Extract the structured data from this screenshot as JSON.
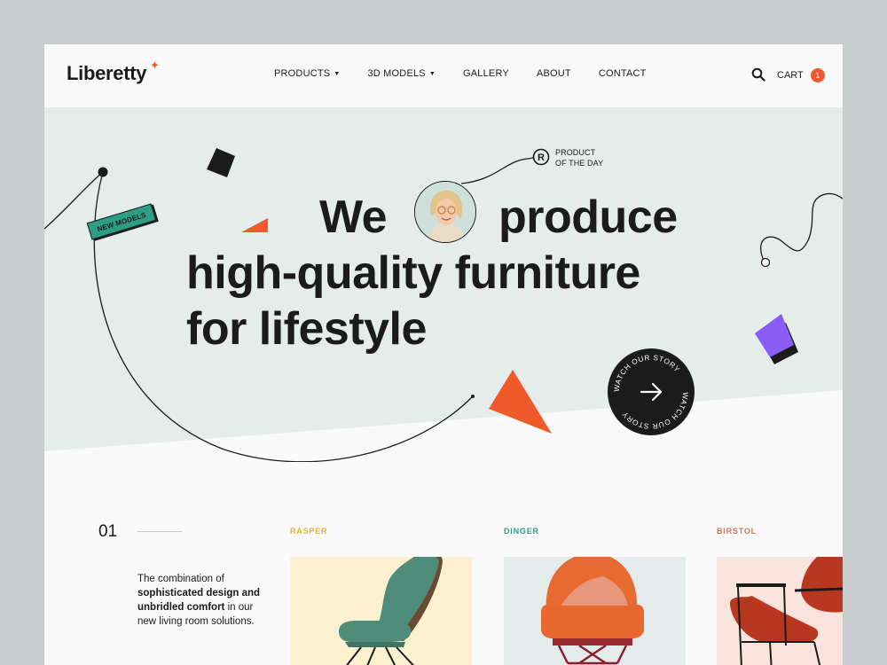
{
  "header": {
    "logo": "Liberetty",
    "nav": [
      {
        "label": "PRODUCTS",
        "dropdown": true
      },
      {
        "label": "3D MODELS",
        "dropdown": true
      },
      {
        "label": "GALLERY",
        "dropdown": false
      },
      {
        "label": "ABOUT",
        "dropdown": false
      },
      {
        "label": "CONTACT",
        "dropdown": false
      }
    ],
    "cart_label": "CART",
    "cart_count": "1"
  },
  "hero": {
    "headline_we": "We",
    "headline_produce": "produce",
    "headline_line2": "high-quality furniture",
    "headline_line3": "for lifestyle",
    "tag": "NEW MODELS",
    "product_of_day_line1": "PRODUCT",
    "product_of_day_line2": "OF THE DAY",
    "watch_text": "WATCH OUR STORY",
    "colors": {
      "bg": "#e5edeb",
      "accent": "#f05a2a",
      "purple": "#8a5cf6",
      "green": "#2d9d86"
    }
  },
  "products": {
    "index": "01",
    "description_pre": "The combination of",
    "description_bold": "sophisticated design and unbridled comfort",
    "description_post": "in our new living room solutions.",
    "items": [
      {
        "name": "RASPER",
        "color": "#e0b43c",
        "bg": "#fdf1cf"
      },
      {
        "name": "DINGER",
        "color": "#2d9d86",
        "bg": "#e3ecea"
      },
      {
        "name": "BIRSTOL",
        "color": "#c97a5c",
        "bg": "#fbe3dd"
      }
    ]
  }
}
